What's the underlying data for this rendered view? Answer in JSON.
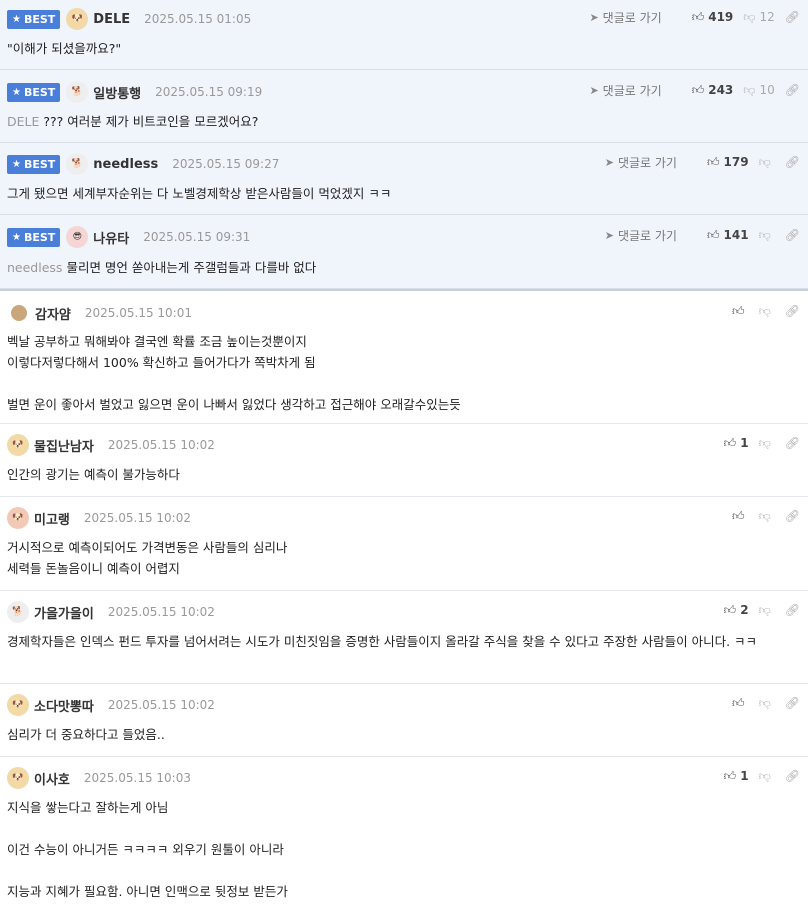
{
  "best_label": "BEST",
  "reply_label": "댓글로 가기",
  "best_comments": [
    {
      "nick": "DELE",
      "date": "2025.05.15 01:05",
      "mention": "",
      "text": "\"이해가 되셨을까요?\"",
      "likes": "419",
      "dislikes": "12",
      "avatar": "dog"
    },
    {
      "nick": "일방통행",
      "date": "2025.05.15 09:19",
      "mention": "DELE",
      "text": "??? 여러분 제가 비트코인을 모르겠어요?",
      "likes": "243",
      "dislikes": "10",
      "avatar": "white-dog"
    },
    {
      "nick": "needless",
      "date": "2025.05.15 09:27",
      "mention": "",
      "text": "그게 됐으면 세계부자순위는 다 노벨경제학상 받은사람들이 먹었겠지 ㅋㅋ",
      "likes": "179",
      "dislikes": "",
      "avatar": "white-dog"
    },
    {
      "nick": "나유타",
      "date": "2025.05.15 09:31",
      "mention": "needless",
      "text": "물리면 명언 쏟아내는게 주갤럼들과 다를바 없다",
      "likes": "141",
      "dislikes": "",
      "avatar": "red-character"
    }
  ],
  "comments": [
    {
      "nick": "감자얌",
      "date": "2025.05.15 10:01",
      "text": "벡날 공부하고 뭐해봐야 결국엔 확률 조금 높이는것뿐이지\n이렇다저렇다해서 100% 확신하고 들어가다가 쪽박차게 됨\n\n벌면 운이 좋아서 벌었고 잃으면 운이 나빠서 잃었다 생각하고 접근해야 오래갈수있는듯",
      "likes": "",
      "avatar": "potato"
    },
    {
      "nick": "물집난남자",
      "date": "2025.05.15 10:02",
      "text": "인간의 광기는 예측이 불가능하다",
      "likes": "1",
      "avatar": "dog"
    },
    {
      "nick": "미고랭",
      "date": "2025.05.15 10:02",
      "text": "거시적으로 예측이되어도 가격변동은 사람들의 심리나\n세력들 돈놀음이니 예측이 어렵지",
      "likes": "",
      "avatar": "red-dog"
    },
    {
      "nick": "가을가을이",
      "date": "2025.05.15 10:02",
      "text": "경제학자들은 인덱스 펀드 투자를 넘어서려는 시도가 미친짓임을 증명한 사람들이지 올라갈 주식을 찾을 수 있다고 주장한 사람들이 아니다. ㅋㅋ",
      "likes": "2",
      "avatar": "white-dog"
    },
    {
      "nick": "소다맛뽕따",
      "date": "2025.05.15 10:02",
      "text": "심리가 더 중요하다고 들었음..",
      "likes": "",
      "avatar": "dog"
    },
    {
      "nick": "이사호",
      "date": "2025.05.15 10:03",
      "text": "지식을 쌓는다고 잘하는게 아님\n\n이건 수능이 아니거든 ㅋㅋㅋㅋ 외우기 원툴이 아니라\n\n지능과 지혜가 필요함. 아니면 인맥으로 뒷정보 받든가",
      "likes": "1",
      "avatar": "dog"
    }
  ],
  "icons": {
    "best": "star-icon",
    "reply": "arrow-icon",
    "like": "thumbs-up-icon",
    "dislike": "thumbs-down-icon",
    "link": "link-icon"
  },
  "colors": {
    "badge": "#4a7fd9",
    "best_bg": "#f0f4fb"
  }
}
